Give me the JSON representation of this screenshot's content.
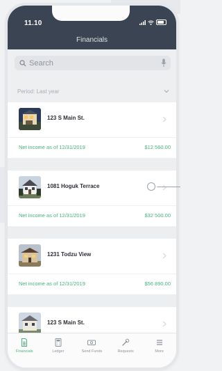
{
  "status_bar": {
    "time": "11.10"
  },
  "header": {
    "title": "Financials"
  },
  "search": {
    "placeholder": "Search"
  },
  "period": {
    "label": "Period: Last year"
  },
  "properties": [
    {
      "address": "123 S Main St.",
      "income_label": "Net income as of 12/31/2019",
      "income_value": "$12 560.00"
    },
    {
      "address": "1081 Hoguk Terrace",
      "income_label": "Net income as of 12/31/2019",
      "income_value": "$32 500.00"
    },
    {
      "address": "1231 Todzu View",
      "income_label": "Net income as of 12/31/2019",
      "income_value": "$56 890.00"
    },
    {
      "address": "123 S Main St."
    }
  ],
  "tabs": [
    {
      "label": "Financials",
      "icon": "document-icon",
      "active": true
    },
    {
      "label": "Ledger",
      "icon": "calculator-icon"
    },
    {
      "label": "Send Funds",
      "icon": "cash-icon"
    },
    {
      "label": "Requests",
      "icon": "wrench-icon"
    },
    {
      "label": "More",
      "icon": "menu-icon"
    }
  ],
  "colors": {
    "header_bg": "#3a4452",
    "accent_green": "#49b37a"
  }
}
